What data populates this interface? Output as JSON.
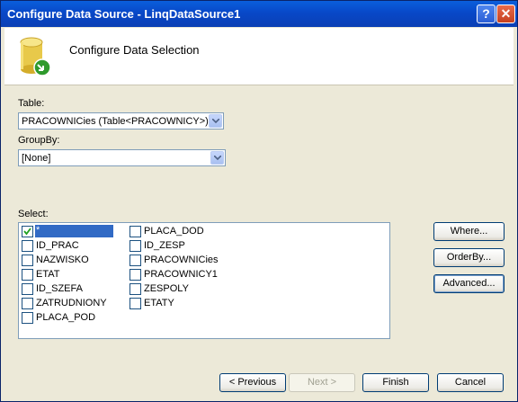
{
  "window": {
    "title": "Configure Data Source - LinqDataSource1"
  },
  "header": {
    "icon": "database-icon",
    "title": "Configure Data Selection"
  },
  "table": {
    "label": "Table:",
    "value": "PRACOWNICies (Table<PRACOWNICY>)"
  },
  "groupby": {
    "label": "GroupBy:",
    "value": "[None]"
  },
  "select": {
    "label": "Select:",
    "columns": [
      [
        {
          "label": "*",
          "checked": true,
          "selected": true
        },
        {
          "label": "ID_PRAC",
          "checked": false
        },
        {
          "label": "NAZWISKO",
          "checked": false
        },
        {
          "label": "ETAT",
          "checked": false
        },
        {
          "label": "ID_SZEFA",
          "checked": false
        },
        {
          "label": "ZATRUDNIONY",
          "checked": false
        },
        {
          "label": "PLACA_POD",
          "checked": false
        }
      ],
      [
        {
          "label": "PLACA_DOD",
          "checked": false
        },
        {
          "label": "ID_ZESP",
          "checked": false
        },
        {
          "label": "PRACOWNICies",
          "checked": false
        },
        {
          "label": "PRACOWNICY1",
          "checked": false
        },
        {
          "label": "ZESPOLY",
          "checked": false
        },
        {
          "label": "ETATY",
          "checked": false
        }
      ]
    ]
  },
  "side_buttons": {
    "where": "Where...",
    "orderby": "OrderBy...",
    "advanced": "Advanced..."
  },
  "footer": {
    "previous": "< Previous",
    "next": "Next >",
    "finish": "Finish",
    "cancel": "Cancel"
  }
}
